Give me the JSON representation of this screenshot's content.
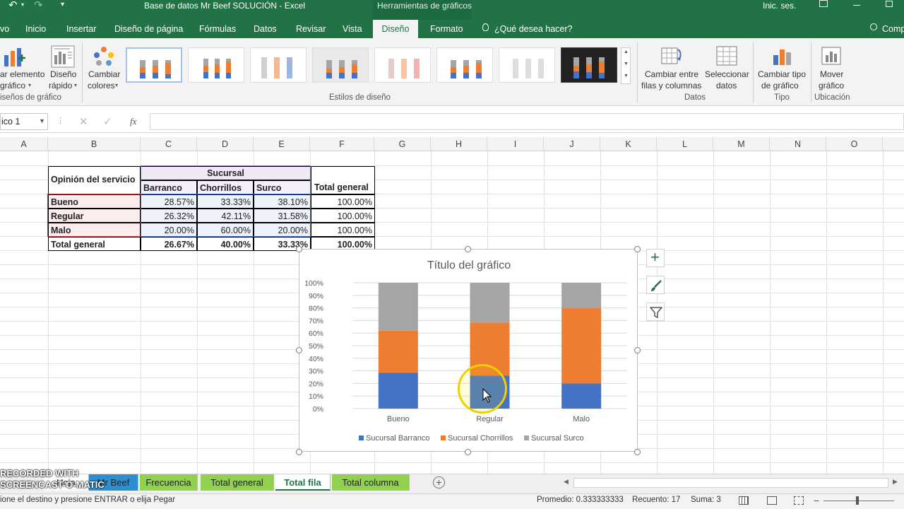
{
  "window": {
    "title": "Base de datos Mr Beef SOLUCIÓN  -  Excel",
    "context_header": "Herramientas de gráficos",
    "sign_in": "Inic. ses."
  },
  "tabs": [
    {
      "label": "vo"
    },
    {
      "label": "Inicio"
    },
    {
      "label": "Insertar"
    },
    {
      "label": "Diseño de página"
    },
    {
      "label": "Fórmulas"
    },
    {
      "label": "Datos"
    },
    {
      "label": "Revisar"
    },
    {
      "label": "Vista"
    },
    {
      "label": "Diseño"
    },
    {
      "label": "Formato"
    }
  ],
  "tell_me": "¿Qué desea hacer?",
  "share": "Comp",
  "ribbon": {
    "add_element": [
      "ar elemento",
      "gráfico"
    ],
    "quick_layout": [
      "Diseño",
      "rápido"
    ],
    "change_colors": [
      "Cambiar",
      "colores"
    ],
    "group_layouts": "iseños de gráfico",
    "group_styles": "Estilos de diseño",
    "switch_row_col": [
      "Cambiar entre",
      "filas y columnas"
    ],
    "select_data": [
      "Seleccionar",
      "datos"
    ],
    "group_data": "Datos",
    "change_type": [
      "Cambiar tipo",
      "de gráfico"
    ],
    "group_type": "Tipo",
    "move_chart": [
      "Mover",
      "gráfico"
    ],
    "group_location": "Ubicación"
  },
  "formula_bar": {
    "name_box": "ico 1",
    "fx": "fx"
  },
  "columns": [
    "A",
    "B",
    "C",
    "D",
    "E",
    "F",
    "G",
    "H",
    "I",
    "J",
    "K",
    "L",
    "M",
    "N",
    "O"
  ],
  "table": {
    "header_b": "Opinión del servicio",
    "header_group": "Sucursal",
    "sub_headers": [
      "Barranco",
      "Chorrillos",
      "Surco"
    ],
    "header_total": "Total general",
    "rows": [
      {
        "label": "Bueno",
        "values": [
          "28.57%",
          "33.33%",
          "38.10%"
        ],
        "total": "100.00%"
      },
      {
        "label": "Regular",
        "values": [
          "26.32%",
          "42.11%",
          "31.58%"
        ],
        "total": "100.00%"
      },
      {
        "label": "Malo",
        "values": [
          "20.00%",
          "60.00%",
          "20.00%"
        ],
        "total": "100.00%"
      }
    ],
    "total_row": {
      "label": "Total general",
      "values": [
        "26.67%",
        "40.00%",
        "33.33%"
      ],
      "total": "100.00%"
    }
  },
  "chart_data": {
    "type": "bar",
    "stacked": "100%",
    "title": "Título del gráfico",
    "categories": [
      "Bueno",
      "Regular",
      "Malo"
    ],
    "series": [
      {
        "name": "Sucursal Barranco",
        "values": [
          28.57,
          26.32,
          20.0
        ],
        "color": "#4472c4"
      },
      {
        "name": "Sucursal Chorrillos",
        "values": [
          33.33,
          42.11,
          60.0
        ],
        "color": "#ed7d31"
      },
      {
        "name": "Sucursal Surco",
        "values": [
          38.1,
          31.58,
          20.0
        ],
        "color": "#a5a5a5"
      }
    ],
    "y_ticks": [
      "0%",
      "10%",
      "20%",
      "30%",
      "40%",
      "50%",
      "60%",
      "70%",
      "80%",
      "90%",
      "100%"
    ],
    "ylim": [
      0,
      100
    ],
    "grid": true,
    "legend": "bottom"
  },
  "sheets": [
    {
      "label": "Hoja",
      "color": "#ffffff"
    },
    {
      "label": "Mr Beef",
      "color": "#2e8fd0"
    },
    {
      "label": "Frecuencia",
      "color": "#92d050"
    },
    {
      "label": "Total general",
      "color": "#92d050"
    },
    {
      "label": "Total fila",
      "color": "#ffffff"
    },
    {
      "label": "Total columna",
      "color": "#92d050"
    }
  ],
  "watermark": "RECORDED WITH SCREENCAST-O-MATIC",
  "status": {
    "message": "ione el destino y presione ENTRAR o elija Pegar",
    "average": "Promedio: 0.333333333",
    "count": "Recuento: 17",
    "sum": "Suma: 3"
  },
  "colors": {
    "excel_green": "#217346"
  }
}
